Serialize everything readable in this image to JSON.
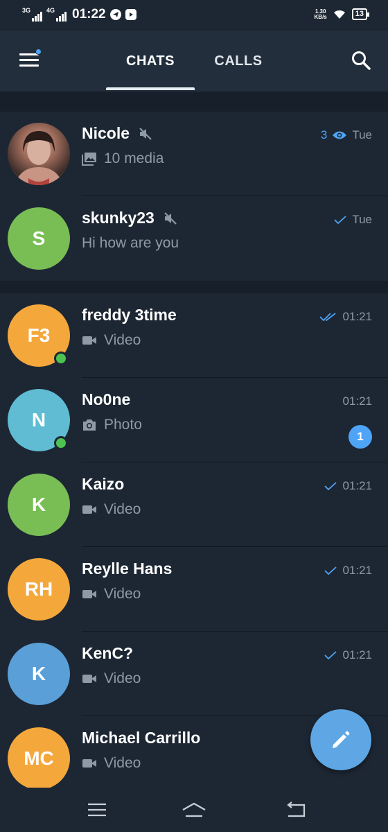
{
  "status_bar": {
    "net1": "3G",
    "net2": "4G",
    "time": "01:22",
    "speed_value": "1.30",
    "speed_unit": "KB/s",
    "battery": "13"
  },
  "header": {
    "tabs": [
      {
        "label": "CHATS",
        "active": true
      },
      {
        "label": "CALLS",
        "active": false
      }
    ],
    "menu_icon": "hamburger-menu-icon",
    "search_icon": "search-icon"
  },
  "colors": {
    "accent": "#4ea4f6",
    "online": "#4dc452",
    "background": "#1d2733",
    "header": "#232e3c"
  },
  "chats": [
    {
      "name": "Nicole",
      "initials": "",
      "avatar_color": "",
      "muted": true,
      "online": false,
      "preview_icon": "gallery-icon",
      "preview": "10 media",
      "views": "3",
      "status": "views",
      "time": "Tue",
      "unread": ""
    },
    {
      "name": "skunky23",
      "initials": "S",
      "avatar_color": "#78be55",
      "muted": true,
      "online": false,
      "preview_icon": "",
      "preview": "Hi how are you",
      "views": "",
      "status": "sent",
      "time": "Tue",
      "unread": ""
    },
    {
      "name": "freddy 3time",
      "initials": "F3",
      "avatar_color": "#f4a83c",
      "muted": false,
      "online": true,
      "preview_icon": "video-icon",
      "preview": "Video",
      "views": "",
      "status": "read",
      "time": "01:21",
      "unread": ""
    },
    {
      "name": "No0ne",
      "initials": "N",
      "avatar_color": "#5fbcd3",
      "muted": false,
      "online": true,
      "preview_icon": "camera-icon",
      "preview": "Photo",
      "views": "",
      "status": "none",
      "time": "01:21",
      "unread": "1"
    },
    {
      "name": "Kaizo",
      "initials": "K",
      "avatar_color": "#78be55",
      "muted": false,
      "online": false,
      "preview_icon": "video-icon",
      "preview": "Video",
      "views": "",
      "status": "sent",
      "time": "01:21",
      "unread": ""
    },
    {
      "name": "Reylle Hans",
      "initials": "RH",
      "avatar_color": "#f4a83c",
      "muted": false,
      "online": false,
      "preview_icon": "video-icon",
      "preview": "Video",
      "views": "",
      "status": "sent",
      "time": "01:21",
      "unread": ""
    },
    {
      "name": "KenC?",
      "initials": "K",
      "avatar_color": "#5a9fd8",
      "muted": false,
      "online": false,
      "preview_icon": "video-icon",
      "preview": "Video",
      "views": "",
      "status": "sent",
      "time": "01:21",
      "unread": ""
    },
    {
      "name": "Michael Carrillo",
      "initials": "MC",
      "avatar_color": "#f4a83c",
      "muted": false,
      "online": false,
      "preview_icon": "video-icon",
      "preview": "Video",
      "views": "",
      "status": "none",
      "time": "",
      "unread": ""
    }
  ],
  "fab": {
    "icon": "pencil-icon"
  },
  "nav_bar": {
    "icons": [
      "menu-icon",
      "home-icon",
      "back-icon"
    ]
  }
}
